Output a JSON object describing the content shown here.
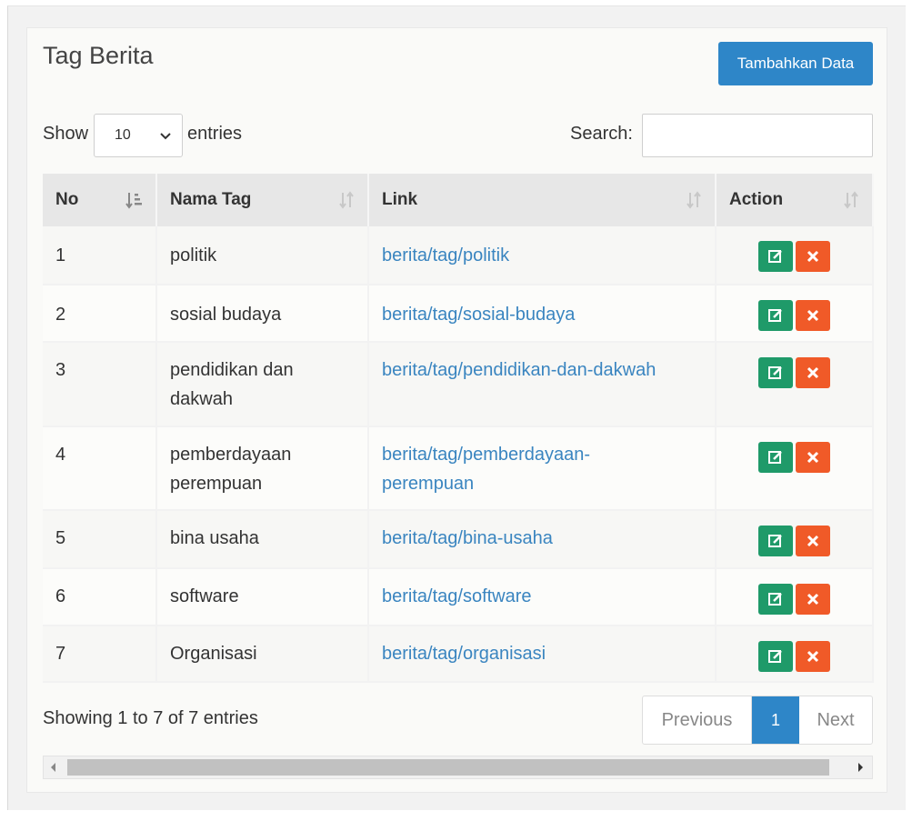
{
  "header": {
    "title": "Tag Berita",
    "add_label": "Tambahkan Data"
  },
  "controls": {
    "show_label": "Show",
    "length_value": "10",
    "entries_label": "entries",
    "search_label": "Search:",
    "search_value": ""
  },
  "table": {
    "columns": [
      "No",
      "Nama Tag",
      "Link",
      "Action"
    ],
    "rows": [
      {
        "no": "1",
        "nama": "politik",
        "link": "berita/tag/politik"
      },
      {
        "no": "2",
        "nama": "sosial budaya",
        "link": "berita/tag/sosial-budaya"
      },
      {
        "no": "3",
        "nama": "pendidikan dan dakwah",
        "link": "berita/tag/pendidikan-dan-dakwah"
      },
      {
        "no": "4",
        "nama": "pemberdayaan perempuan",
        "link": "berita/tag/pemberdayaan-perempuan"
      },
      {
        "no": "5",
        "nama": "bina usaha",
        "link": "berita/tag/bina-usaha"
      },
      {
        "no": "6",
        "nama": "software",
        "link": "berita/tag/software"
      },
      {
        "no": "7",
        "nama": "Organisasi",
        "link": "berita/tag/organisasi"
      }
    ]
  },
  "footer": {
    "info": "Showing 1 to 7 of 7 entries",
    "prev_label": "Previous",
    "current_page": "1",
    "next_label": "Next"
  },
  "colors": {
    "primary": "#2e86c8",
    "edit": "#1f9a69",
    "delete": "#f05a28",
    "link": "#3a85c0"
  }
}
